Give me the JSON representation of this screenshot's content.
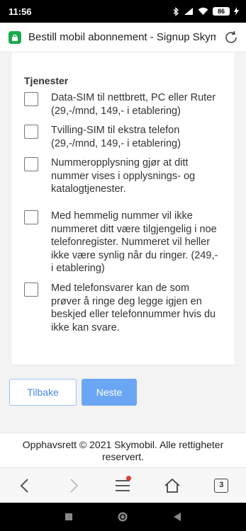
{
  "status_bar": {
    "time": "11:56",
    "battery": "86",
    "icons": [
      "bluetooth-icon",
      "signal-icon",
      "wifi-icon",
      "battery-icon",
      "charging-icon"
    ]
  },
  "browser": {
    "url_title": "Bestill mobil abonnement - Signup Skymo",
    "tab_count": "3"
  },
  "form": {
    "section_title": "Tjenester",
    "options": [
      {
        "label": "Data-SIM til nettbrett, PC eller Ruter (29,-/mnd, 149,- i etablering)",
        "checked": false
      },
      {
        "label": "Tvilling-SIM til ekstra telefon (29,-/mnd, 149,- i etablering)",
        "checked": false
      },
      {
        "label": "Nummeropplysning gjør at ditt nummer vises i opplysnings- og katalogtjenester.",
        "checked": false
      },
      {
        "label": "Med hemmelig nummer vil ikke nummeret ditt være tilgjengelig i noe telefonregister. Nummeret vil heller ikke være synlig når du ringer. (249,- i etablering)",
        "checked": false
      },
      {
        "label": "Med telefonsvarer kan de som prøver å ringe deg legge igjen en beskjed eller telefonnummer hvis du ikke kan svare.",
        "checked": false
      }
    ],
    "back_label": "Tilbake",
    "next_label": "Neste"
  },
  "footer": {
    "text": "Opphavsrett © 2021 Skymobil. Alle rettigheter reservert."
  },
  "colors": {
    "lock_green": "#1aa94a",
    "primary_blue": "#6ba6f5",
    "outline_blue": "#9cc2f4",
    "notification_red": "#e53935"
  }
}
